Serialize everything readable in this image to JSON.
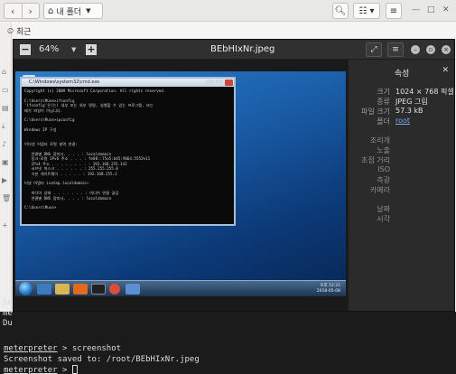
{
  "files": {
    "path_label": "내 폴더",
    "recent_label": "최근"
  },
  "viewer": {
    "zoom": "64%",
    "title": "BEbHIxNr.jpeg",
    "zoom_out": "−",
    "zoom_in": "+"
  },
  "properties": {
    "title": "속성",
    "rows": [
      {
        "key": "크기",
        "value": "1024 × 768 픽셀"
      },
      {
        "key": "종류",
        "value": "JPEG 그림"
      },
      {
        "key": "파일 크기",
        "value": "57.3 kB"
      },
      {
        "key": "폴더",
        "value": "root"
      }
    ],
    "extra_keys": [
      "조리개",
      "노출",
      "초점 거리",
      "ISO",
      "측광",
      "카메라"
    ],
    "extra_keys2": [
      "날짜",
      "시각"
    ]
  },
  "screenshot_content": {
    "cmd_title": "C:\\Windows\\system32\\cmd.exe",
    "cmd_lines": [
      "Copyright (c) 2009 Microsoft Corporation. All rights reserved.",
      "",
      "C:\\Users\\Muse>ifconfig",
      "'ifconfig'은(는) 내부 또는 외부 명령, 실행할 수 있는 프로그램, 또는",
      "배치 파일이 아닙니다.",
      "",
      "C:\\Users\\Muse>ipconfig",
      "",
      "Windows IP 구성",
      "",
      "",
      "이더넷 어댑터 로컬 영역 연결:",
      "",
      "   연결별 DNS 접미사. . . . : localdomain",
      "   링크-로컬 IPv6 주소 . . . : fe80::75a5:b45:9864:5552%11",
      "   IPv4 주소 . . . . . . . . : 192.168.255.142",
      "   서브넷 마스크 . . . . . . : 255.255.255.0",
      "   기본 게이트웨이 . . . . . : 192.168.255.2",
      "",
      "터널 어댑터 isatap.localdomain:",
      "",
      "   미디어 상태 . . . . . . . : 미디어 연결 끊김",
      "   연결별 DNS 접미사. . . . : localdomain",
      "",
      "C:\\Users\\Muse>"
    ],
    "clock_time": "오후 12:21",
    "clock_date": "2018-05-08"
  },
  "terminal": {
    "frag1": "Se",
    "frag2": "me",
    "frag3": "Du",
    "line1_prompt": "meterpreter",
    "line1_cmd": " > screenshot",
    "line2": "Screenshot saved to: /root/BEbHIxNr.jpeg",
    "line3_prompt": "meterpreter",
    "line3_cmd": " > "
  },
  "colors": {
    "link": "#78a8e6",
    "terminal_bg": "#1b1b1b",
    "viewer_bg": "#2a2a2a"
  }
}
